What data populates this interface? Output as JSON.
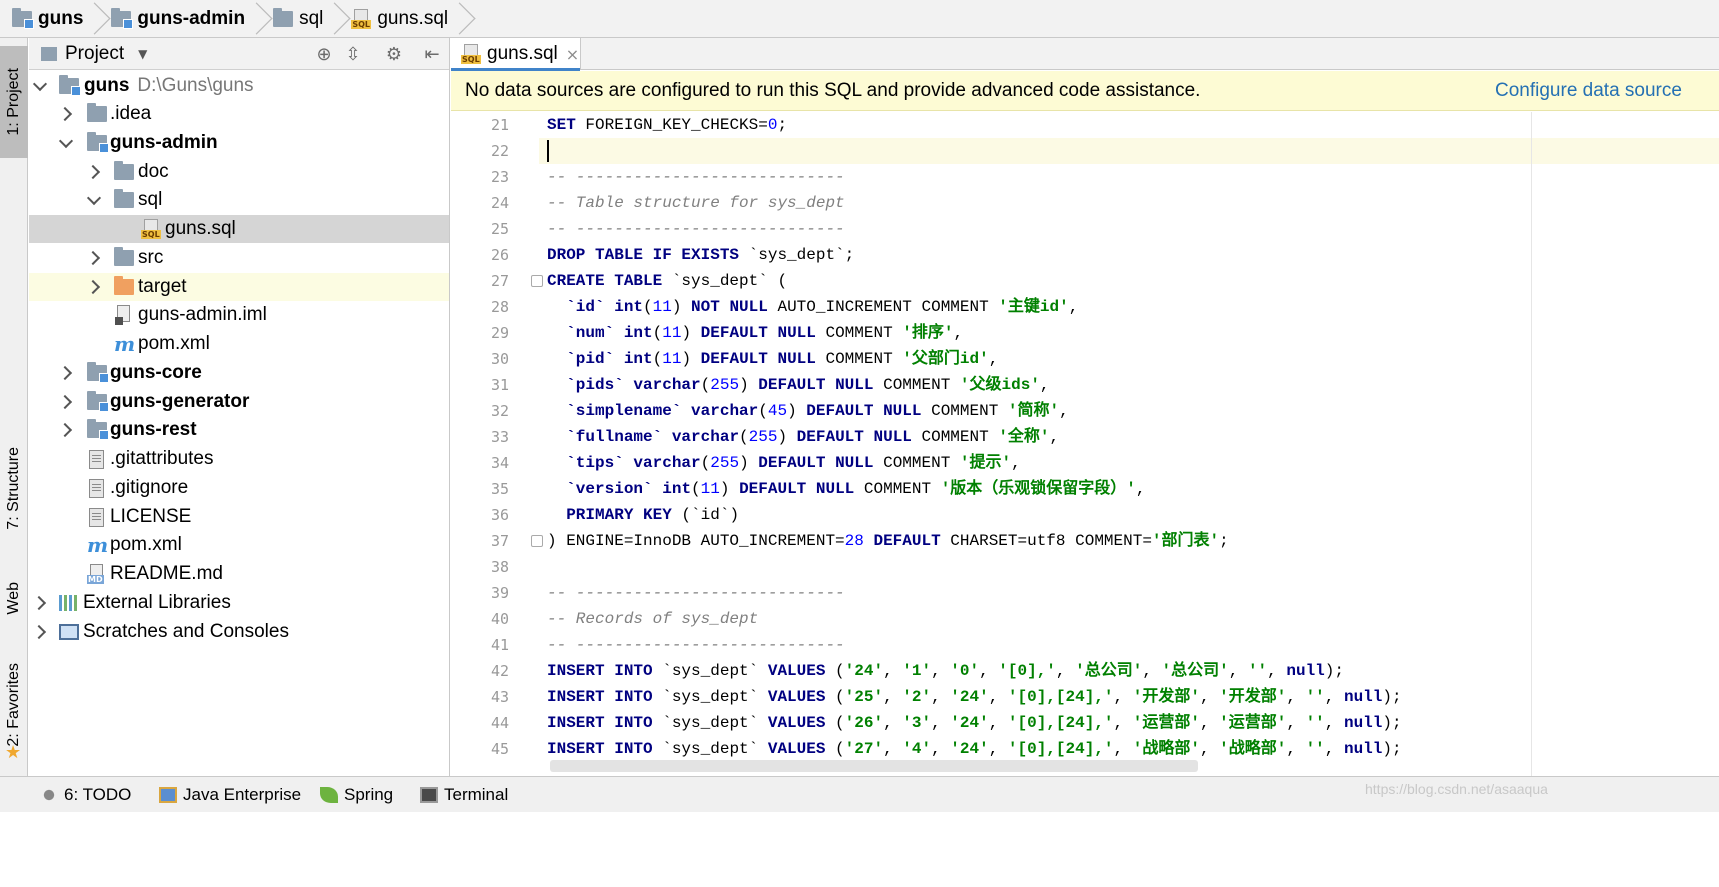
{
  "breadcrumb": {
    "items": [
      {
        "label": "guns",
        "icon": "module-folder-icon",
        "bold": true
      },
      {
        "label": "guns-admin",
        "icon": "module-folder-icon",
        "bold": true
      },
      {
        "label": "sql",
        "icon": "folder-icon",
        "bold": false
      },
      {
        "label": "guns.sql",
        "icon": "sql-file-icon",
        "bold": false
      }
    ]
  },
  "left_stripe": {
    "project": "1: Project",
    "structure": "7: Structure",
    "web": "Web",
    "favorites": "2: Favorites"
  },
  "project_panel": {
    "title": "Project",
    "tree": [
      {
        "label": "guns",
        "path": "D:\\Guns\\guns",
        "bold": true,
        "expanded": true
      },
      {
        "label": ".idea",
        "bold": false
      },
      {
        "label": "guns-admin",
        "bold": true,
        "expanded": true
      },
      {
        "label": "doc",
        "bold": false
      },
      {
        "label": "sql",
        "bold": false,
        "expanded": true
      },
      {
        "label": "guns.sql",
        "bold": false,
        "selected": true
      },
      {
        "label": "src",
        "bold": false
      },
      {
        "label": "target",
        "bold": false
      },
      {
        "label": "guns-admin.iml",
        "bold": false
      },
      {
        "label": "pom.xml",
        "bold": false
      },
      {
        "label": "guns-core",
        "bold": true
      },
      {
        "label": "guns-generator",
        "bold": true
      },
      {
        "label": "guns-rest",
        "bold": true
      },
      {
        "label": ".gitattributes",
        "bold": false
      },
      {
        "label": ".gitignore",
        "bold": false
      },
      {
        "label": "LICENSE",
        "bold": false
      },
      {
        "label": "pom.xml",
        "bold": false
      },
      {
        "label": "README.md",
        "bold": false
      },
      {
        "label": "External Libraries",
        "bold": false
      },
      {
        "label": "Scratches and Consoles",
        "bold": false
      }
    ]
  },
  "editor": {
    "tab": {
      "label": "guns.sql",
      "close": "×"
    },
    "banner": {
      "message": "No data sources are configured to run this SQL and provide advanced code assistance.",
      "link": "Configure data source"
    },
    "line_numbers": [
      "21",
      "22",
      "23",
      "24",
      "25",
      "26",
      "27",
      "28",
      "29",
      "30",
      "31",
      "32",
      "33",
      "34",
      "35",
      "36",
      "37",
      "38",
      "39",
      "40",
      "41",
      "42",
      "43",
      "44",
      "45"
    ],
    "lines": [
      [
        {
          "t": "k",
          "v": "SET"
        },
        {
          "t": "t",
          "v": " FOREIGN_KEY_CHECKS="
        },
        {
          "t": "n",
          "v": "0"
        },
        {
          "t": "t",
          "v": ";"
        }
      ],
      [],
      [
        {
          "t": "c",
          "v": "-- ----------------------------"
        }
      ],
      [
        {
          "t": "c",
          "v": "-- Table structure for sys_dept"
        }
      ],
      [
        {
          "t": "c",
          "v": "-- ----------------------------"
        }
      ],
      [
        {
          "t": "k",
          "v": "DROP TABLE IF EXISTS"
        },
        {
          "t": "t",
          "v": " `sys_dept`;"
        }
      ],
      [
        {
          "t": "k",
          "v": "CREATE TABLE"
        },
        {
          "t": "t",
          "v": " `sys_dept` ("
        }
      ],
      [
        {
          "t": "t",
          "v": "  "
        },
        {
          "t": "k",
          "v": "`id`"
        },
        {
          "t": "t",
          "v": " "
        },
        {
          "t": "k",
          "v": "int"
        },
        {
          "t": "t",
          "v": "("
        },
        {
          "t": "n",
          "v": "11"
        },
        {
          "t": "t",
          "v": ") "
        },
        {
          "t": "k",
          "v": "NOT NULL"
        },
        {
          "t": "t",
          "v": " AUTO_INCREMENT COMMENT "
        },
        {
          "t": "s",
          "v": "'主键id'"
        },
        {
          "t": "t",
          "v": ","
        }
      ],
      [
        {
          "t": "t",
          "v": "  "
        },
        {
          "t": "k",
          "v": "`num`"
        },
        {
          "t": "t",
          "v": " "
        },
        {
          "t": "k",
          "v": "int"
        },
        {
          "t": "t",
          "v": "("
        },
        {
          "t": "n",
          "v": "11"
        },
        {
          "t": "t",
          "v": ") "
        },
        {
          "t": "k",
          "v": "DEFAULT NULL"
        },
        {
          "t": "t",
          "v": " COMMENT "
        },
        {
          "t": "s",
          "v": "'排序'"
        },
        {
          "t": "t",
          "v": ","
        }
      ],
      [
        {
          "t": "t",
          "v": "  "
        },
        {
          "t": "k",
          "v": "`pid`"
        },
        {
          "t": "t",
          "v": " "
        },
        {
          "t": "k",
          "v": "int"
        },
        {
          "t": "t",
          "v": "("
        },
        {
          "t": "n",
          "v": "11"
        },
        {
          "t": "t",
          "v": ") "
        },
        {
          "t": "k",
          "v": "DEFAULT NULL"
        },
        {
          "t": "t",
          "v": " COMMENT "
        },
        {
          "t": "s",
          "v": "'父部门id'"
        },
        {
          "t": "t",
          "v": ","
        }
      ],
      [
        {
          "t": "t",
          "v": "  "
        },
        {
          "t": "k",
          "v": "`pids`"
        },
        {
          "t": "t",
          "v": " "
        },
        {
          "t": "k",
          "v": "varchar"
        },
        {
          "t": "t",
          "v": "("
        },
        {
          "t": "n",
          "v": "255"
        },
        {
          "t": "t",
          "v": ") "
        },
        {
          "t": "k",
          "v": "DEFAULT NULL"
        },
        {
          "t": "t",
          "v": " COMMENT "
        },
        {
          "t": "s",
          "v": "'父级ids'"
        },
        {
          "t": "t",
          "v": ","
        }
      ],
      [
        {
          "t": "t",
          "v": "  "
        },
        {
          "t": "k",
          "v": "`simplename`"
        },
        {
          "t": "t",
          "v": " "
        },
        {
          "t": "k",
          "v": "varchar"
        },
        {
          "t": "t",
          "v": "("
        },
        {
          "t": "n",
          "v": "45"
        },
        {
          "t": "t",
          "v": ") "
        },
        {
          "t": "k",
          "v": "DEFAULT NULL"
        },
        {
          "t": "t",
          "v": " COMMENT "
        },
        {
          "t": "s",
          "v": "'简称'"
        },
        {
          "t": "t",
          "v": ","
        }
      ],
      [
        {
          "t": "t",
          "v": "  "
        },
        {
          "t": "k",
          "v": "`fullname`"
        },
        {
          "t": "t",
          "v": " "
        },
        {
          "t": "k",
          "v": "varchar"
        },
        {
          "t": "t",
          "v": "("
        },
        {
          "t": "n",
          "v": "255"
        },
        {
          "t": "t",
          "v": ") "
        },
        {
          "t": "k",
          "v": "DEFAULT NULL"
        },
        {
          "t": "t",
          "v": " COMMENT "
        },
        {
          "t": "s",
          "v": "'全称'"
        },
        {
          "t": "t",
          "v": ","
        }
      ],
      [
        {
          "t": "t",
          "v": "  "
        },
        {
          "t": "k",
          "v": "`tips`"
        },
        {
          "t": "t",
          "v": " "
        },
        {
          "t": "k",
          "v": "varchar"
        },
        {
          "t": "t",
          "v": "("
        },
        {
          "t": "n",
          "v": "255"
        },
        {
          "t": "t",
          "v": ") "
        },
        {
          "t": "k",
          "v": "DEFAULT NULL"
        },
        {
          "t": "t",
          "v": " COMMENT "
        },
        {
          "t": "s",
          "v": "'提示'"
        },
        {
          "t": "t",
          "v": ","
        }
      ],
      [
        {
          "t": "t",
          "v": "  "
        },
        {
          "t": "k",
          "v": "`version`"
        },
        {
          "t": "t",
          "v": " "
        },
        {
          "t": "k",
          "v": "int"
        },
        {
          "t": "t",
          "v": "("
        },
        {
          "t": "n",
          "v": "11"
        },
        {
          "t": "t",
          "v": ") "
        },
        {
          "t": "k",
          "v": "DEFAULT NULL"
        },
        {
          "t": "t",
          "v": " COMMENT "
        },
        {
          "t": "s",
          "v": "'版本（乐观锁保留字段）'"
        },
        {
          "t": "t",
          "v": ","
        }
      ],
      [
        {
          "t": "t",
          "v": "  "
        },
        {
          "t": "k",
          "v": "PRIMARY KEY"
        },
        {
          "t": "t",
          "v": " (`id`)"
        }
      ],
      [
        {
          "t": "t",
          "v": ") ENGINE=InnoDB AUTO_INCREMENT="
        },
        {
          "t": "n",
          "v": "28"
        },
        {
          "t": "t",
          "v": " "
        },
        {
          "t": "k",
          "v": "DEFAULT"
        },
        {
          "t": "t",
          "v": " CHARSET=utf8 COMMENT="
        },
        {
          "t": "s",
          "v": "'部门表'"
        },
        {
          "t": "t",
          "v": ";"
        }
      ],
      [],
      [
        {
          "t": "c",
          "v": "-- ----------------------------"
        }
      ],
      [
        {
          "t": "c",
          "v": "-- Records of sys_dept"
        }
      ],
      [
        {
          "t": "c",
          "v": "-- ----------------------------"
        }
      ],
      [
        {
          "t": "k",
          "v": "INSERT INTO"
        },
        {
          "t": "t",
          "v": " `sys_dept` "
        },
        {
          "t": "k",
          "v": "VALUES"
        },
        {
          "t": "t",
          "v": " ("
        },
        {
          "t": "s",
          "v": "'24'"
        },
        {
          "t": "t",
          "v": ", "
        },
        {
          "t": "s",
          "v": "'1'"
        },
        {
          "t": "t",
          "v": ", "
        },
        {
          "t": "s",
          "v": "'0'"
        },
        {
          "t": "t",
          "v": ", "
        },
        {
          "t": "s",
          "v": "'[0],'"
        },
        {
          "t": "t",
          "v": ", "
        },
        {
          "t": "s",
          "v": "'总公司'"
        },
        {
          "t": "t",
          "v": ", "
        },
        {
          "t": "s",
          "v": "'总公司'"
        },
        {
          "t": "t",
          "v": ", "
        },
        {
          "t": "s",
          "v": "''"
        },
        {
          "t": "t",
          "v": ", "
        },
        {
          "t": "k",
          "v": "null"
        },
        {
          "t": "t",
          "v": ");"
        }
      ],
      [
        {
          "t": "k",
          "v": "INSERT INTO"
        },
        {
          "t": "t",
          "v": " `sys_dept` "
        },
        {
          "t": "k",
          "v": "VALUES"
        },
        {
          "t": "t",
          "v": " ("
        },
        {
          "t": "s",
          "v": "'25'"
        },
        {
          "t": "t",
          "v": ", "
        },
        {
          "t": "s",
          "v": "'2'"
        },
        {
          "t": "t",
          "v": ", "
        },
        {
          "t": "s",
          "v": "'24'"
        },
        {
          "t": "t",
          "v": ", "
        },
        {
          "t": "s",
          "v": "'[0],[24],'"
        },
        {
          "t": "t",
          "v": ", "
        },
        {
          "t": "s",
          "v": "'开发部'"
        },
        {
          "t": "t",
          "v": ", "
        },
        {
          "t": "s",
          "v": "'开发部'"
        },
        {
          "t": "t",
          "v": ", "
        },
        {
          "t": "s",
          "v": "''"
        },
        {
          "t": "t",
          "v": ", "
        },
        {
          "t": "k",
          "v": "null"
        },
        {
          "t": "t",
          "v": ");"
        }
      ],
      [
        {
          "t": "k",
          "v": "INSERT INTO"
        },
        {
          "t": "t",
          "v": " `sys_dept` "
        },
        {
          "t": "k",
          "v": "VALUES"
        },
        {
          "t": "t",
          "v": " ("
        },
        {
          "t": "s",
          "v": "'26'"
        },
        {
          "t": "t",
          "v": ", "
        },
        {
          "t": "s",
          "v": "'3'"
        },
        {
          "t": "t",
          "v": ", "
        },
        {
          "t": "s",
          "v": "'24'"
        },
        {
          "t": "t",
          "v": ", "
        },
        {
          "t": "s",
          "v": "'[0],[24],'"
        },
        {
          "t": "t",
          "v": ", "
        },
        {
          "t": "s",
          "v": "'运营部'"
        },
        {
          "t": "t",
          "v": ", "
        },
        {
          "t": "s",
          "v": "'运营部'"
        },
        {
          "t": "t",
          "v": ", "
        },
        {
          "t": "s",
          "v": "''"
        },
        {
          "t": "t",
          "v": ", "
        },
        {
          "t": "k",
          "v": "null"
        },
        {
          "t": "t",
          "v": ");"
        }
      ],
      [
        {
          "t": "k",
          "v": "INSERT INTO"
        },
        {
          "t": "t",
          "v": " `sys_dept` "
        },
        {
          "t": "k",
          "v": "VALUES"
        },
        {
          "t": "t",
          "v": " ("
        },
        {
          "t": "s",
          "v": "'27'"
        },
        {
          "t": "t",
          "v": ", "
        },
        {
          "t": "s",
          "v": "'4'"
        },
        {
          "t": "t",
          "v": ", "
        },
        {
          "t": "s",
          "v": "'24'"
        },
        {
          "t": "t",
          "v": ", "
        },
        {
          "t": "s",
          "v": "'[0],[24],'"
        },
        {
          "t": "t",
          "v": ", "
        },
        {
          "t": "s",
          "v": "'战略部'"
        },
        {
          "t": "t",
          "v": ", "
        },
        {
          "t": "s",
          "v": "'战略部'"
        },
        {
          "t": "t",
          "v": ", "
        },
        {
          "t": "s",
          "v": "''"
        },
        {
          "t": "t",
          "v": ", "
        },
        {
          "t": "k",
          "v": "null"
        },
        {
          "t": "t",
          "v": ");"
        }
      ]
    ]
  },
  "bottom_bar": {
    "todo": "6: TODO",
    "java_enterprise": "Java Enterprise",
    "spring": "Spring",
    "terminal": "Terminal"
  },
  "watermark": "https://blog.csdn.net/asaaqua"
}
